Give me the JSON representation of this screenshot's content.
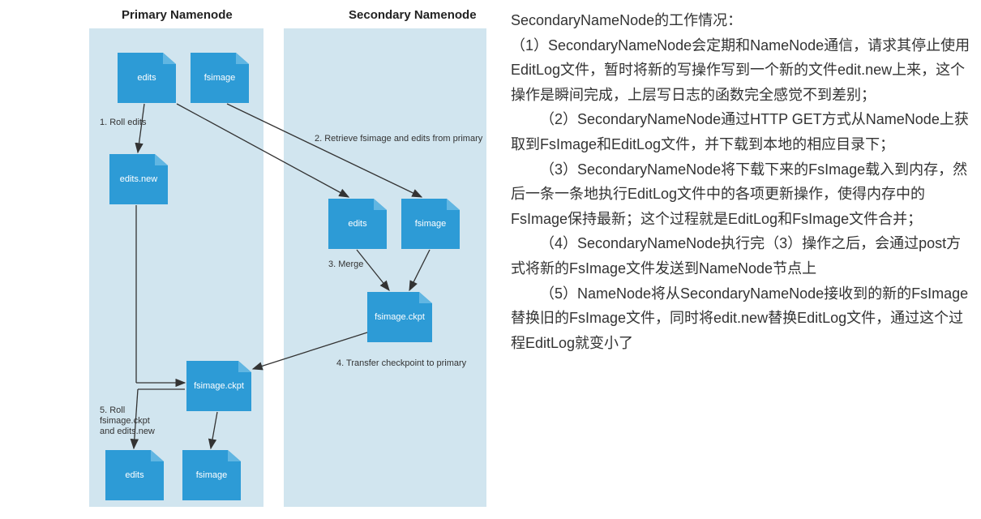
{
  "diagram": {
    "header_primary": "Primary Namenode",
    "header_secondary": "Secondary Namenode",
    "nodes": {
      "p_edits_top": "edits",
      "p_fsimage_top": "fsimage",
      "p_edits_new": "edits.new",
      "s_edits": "edits",
      "s_fsimage": "fsimage",
      "s_fsimage_ckpt": "fsimage.ckpt",
      "p_fsimage_ckpt": "fsimage.ckpt",
      "p_edits_bottom": "edits",
      "p_fsimage_bottom": "fsimage"
    },
    "steps": {
      "s1": "1. Roll edits",
      "s2": "2. Retrieve fsimage and edits from primary",
      "s3": "3. Merge",
      "s4": "4. Transfer checkpoint to primary",
      "s5": "5. Roll\nfsimage.ckpt\nand edits.new"
    }
  },
  "text": {
    "title": "SecondaryNameNode的工作情况：",
    "p1": "（1）SecondaryNameNode会定期和NameNode通信，请求其停止使用EditLog文件，暂时将新的写操作写到一个新的文件edit.new上来，这个操作是瞬间完成，上层写日志的函数完全感觉不到差别；",
    "p2": "（2）SecondaryNameNode通过HTTP GET方式从NameNode上获取到FsImage和EditLog文件，并下载到本地的相应目录下；",
    "p3": "（3）SecondaryNameNode将下载下来的FsImage载入到内存，然后一条一条地执行EditLog文件中的各项更新操作，使得内存中的FsImage保持最新；这个过程就是EditLog和FsImage文件合并；",
    "p4": "（4）SecondaryNameNode执行完（3）操作之后，会通过post方式将新的FsImage文件发送到NameNode节点上",
    "p5": "（5）NameNode将从SecondaryNameNode接收到的新的FsImage替换旧的FsImage文件，同时将edit.new替换EditLog文件，通过这个过程EditLog就变小了"
  }
}
